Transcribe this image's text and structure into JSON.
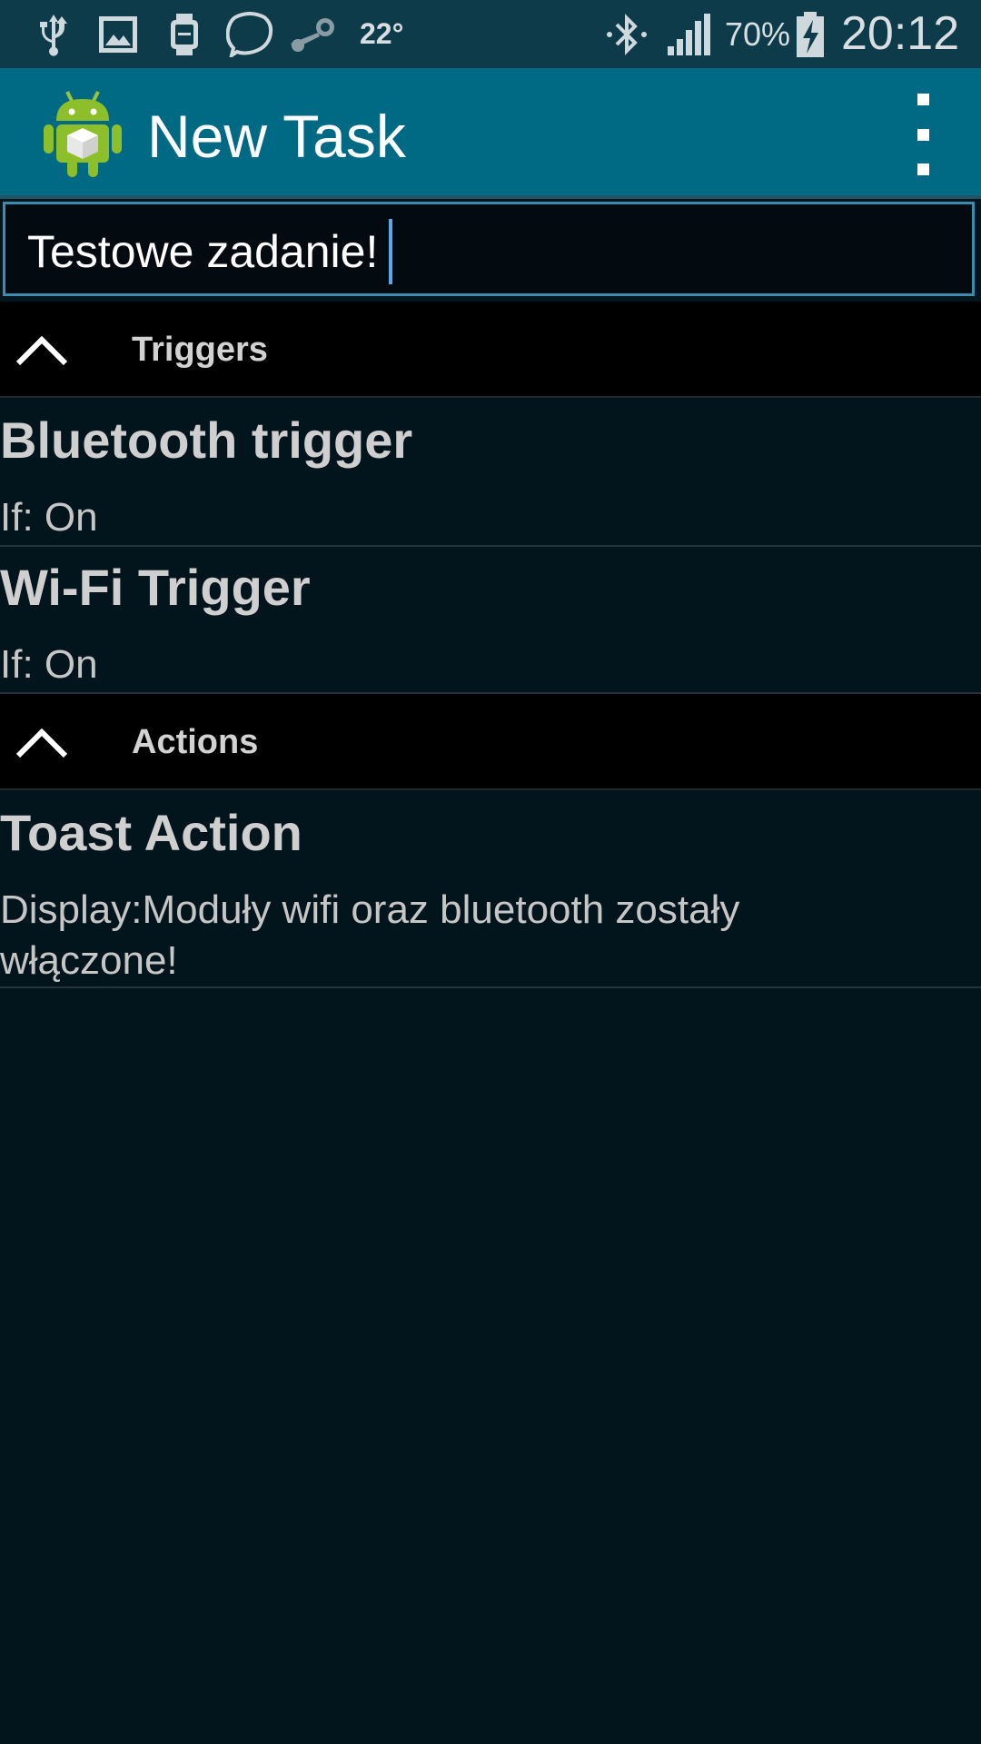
{
  "status_bar": {
    "icons_left": [
      "usb-icon",
      "image-notification-icon",
      "smartwatch-icon",
      "chat-bubble-icon",
      "steam-icon"
    ],
    "weather_temp": "22°",
    "icons_right": [
      "bluetooth-icon",
      "signal-icon"
    ],
    "battery_percent": "70%",
    "battery_icon": "battery-charging-icon",
    "time": "20:12"
  },
  "action_bar": {
    "app_icon": "android-app-icon",
    "title": "New Task",
    "overflow_icon": "overflow-menu-icon"
  },
  "task_name": {
    "value": "Testowe zadanie!"
  },
  "sections": {
    "triggers": {
      "title": "Triggers",
      "icon": "chevron-up-icon",
      "items": [
        {
          "title": "Bluetooth trigger",
          "subtitle": "If: On"
        },
        {
          "title": "Wi-Fi Trigger",
          "subtitle": "If: On"
        }
      ]
    },
    "actions": {
      "title": "Actions",
      "icon": "chevron-up-icon",
      "items": [
        {
          "title": "Toast Action",
          "subtitle": "Display:Moduły wifi oraz bluetooth zostały włączone!"
        }
      ]
    }
  },
  "colors": {
    "status_bar_bg": "#0e3b4a",
    "action_bar_bg": "#006a85",
    "screen_bg": "#02141c",
    "section_header_bg": "#000000",
    "field_border": "#3c8cb0",
    "caret": "#5aa8e8"
  }
}
